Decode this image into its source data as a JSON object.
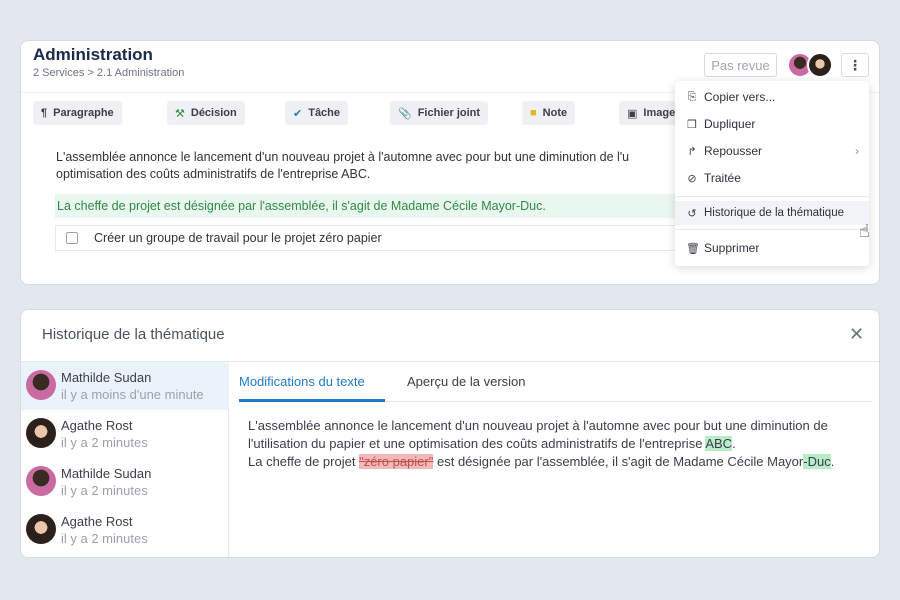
{
  "header": {
    "title": "Administration",
    "breadcrumb": "2 Services > 2.1 Administration",
    "status_button": "Pas revue",
    "more_icon": "kebab-icon"
  },
  "toolbar": {
    "items": [
      {
        "label": "Paragraphe",
        "icon": "paragraph-icon"
      },
      {
        "label": "Décision",
        "icon": "gavel-icon"
      },
      {
        "label": "Tâche",
        "icon": "check-icon"
      },
      {
        "label": "Fichier joint",
        "icon": "paperclip-icon"
      },
      {
        "label": "Note",
        "icon": "note-icon"
      },
      {
        "label": "Image",
        "icon": "image-icon"
      }
    ]
  },
  "content": {
    "paragraph": "L'assemblée annonce le lancement d'un nouveau projet à l'automne avec pour but une diminution de l'utilisation du papier et une optimisation des coûts administratifs de l'entreprise ABC.",
    "paragraph_line1": "L'assemblée annonce le lancement d'un nouveau projet à l'automne avec pour but une diminution de l'u",
    "paragraph_line2": "optimisation des coûts administratifs de l'entreprise ABC.",
    "decision": "La cheffe de projet est désignée par l'assemblée, il s'agit de Madame Cécile Mayor-Duc.",
    "task": "Créer un groupe de travail pour le projet zéro papier"
  },
  "menu": {
    "items": [
      {
        "label": "Copier vers...",
        "icon": "copy-to-icon"
      },
      {
        "label": "Dupliquer",
        "icon": "duplicate-icon"
      },
      {
        "label": "Repousser",
        "icon": "share-icon",
        "submenu": true
      },
      {
        "label": "Traitée",
        "icon": "check-circle-icon"
      },
      {
        "label": "Historique de la thématique",
        "icon": "history-icon"
      },
      {
        "label": "Supprimer",
        "icon": "trash-icon"
      }
    ],
    "hovered": "Historique de la thématique"
  },
  "history": {
    "title": "Historique de la thématique",
    "versions": [
      {
        "name": "Mathilde Sudan",
        "time": "il y a moins d'une minute",
        "active": true
      },
      {
        "name": "Agathe Rost",
        "time": "il y a 2 minutes",
        "active": false
      },
      {
        "name": "Mathilde Sudan",
        "time": "il y a 2 minutes",
        "active": false
      },
      {
        "name": "Agathe Rost",
        "time": "il y a 2 minutes",
        "active": false
      }
    ],
    "tabs": [
      {
        "label": "Modifications du texte",
        "active": true
      },
      {
        "label": "Aperçu de la version",
        "active": false
      }
    ],
    "diff": {
      "p1_text": "L'assemblée annonce le lancement d'un nouveau projet à l'automne avec pour but une diminution de l'utilisation du papier et une optimisation des coûts administratifs de l'entreprise",
      "p1_inserted": "ABC",
      "p1_end": ".",
      "p2_start": "La cheffe de projet",
      "p2_deleted": "\"zéro papier\"",
      "p2_middle": "est désignée par l'assemblée, il s'agit de Madame Cécile Mayor",
      "p2_inserted": "-Duc",
      "p2_end": "."
    }
  },
  "colors": {
    "accent": "#1f7bc9",
    "decision_bg": "#eaf7ee",
    "decision_text": "#2f8a47",
    "insert_bg": "#b9ebc8",
    "delete_bg": "#f3b8b8"
  }
}
